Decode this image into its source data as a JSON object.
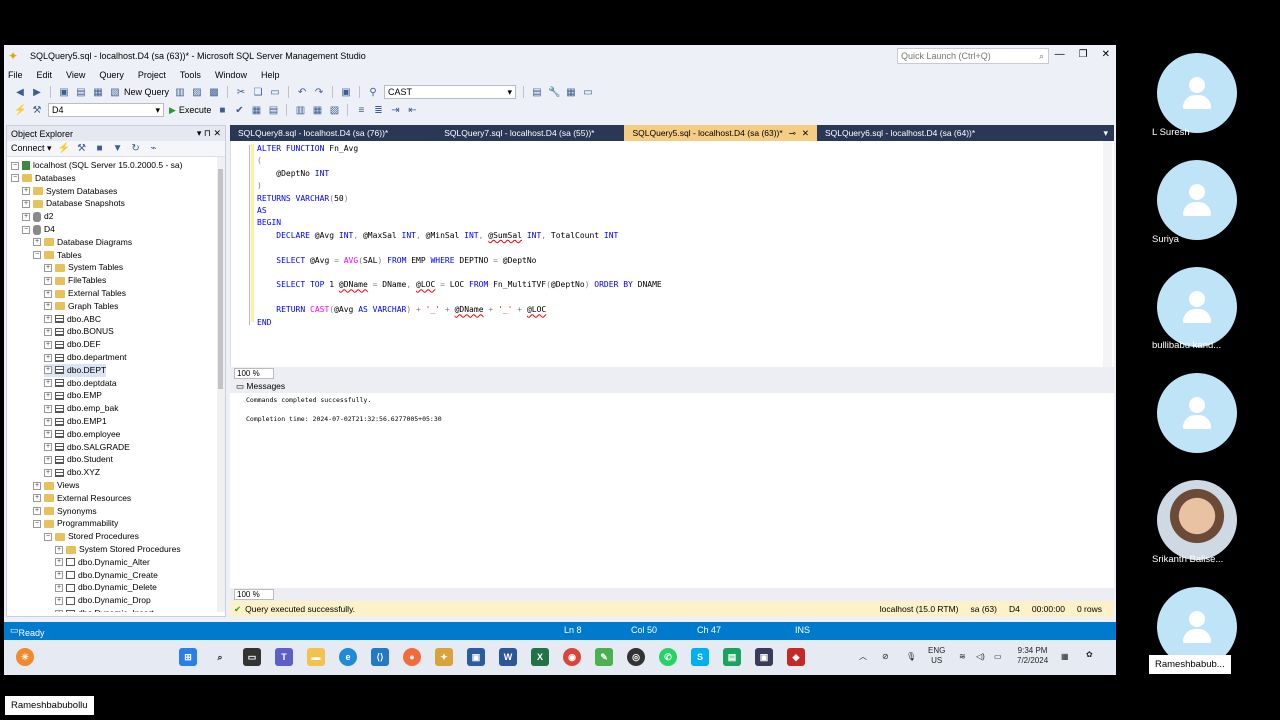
{
  "window": {
    "title": "SQLQuery5.sql - localhost.D4 (sa (63))* - Microsoft SQL Server Management Studio",
    "quick_launch_placeholder": "Quick Launch (Ctrl+Q)"
  },
  "menu": [
    "File",
    "Edit",
    "View",
    "Query",
    "Project",
    "Tools",
    "Window",
    "Help"
  ],
  "toolbar": {
    "new_query": "New Query",
    "search_combo": "CAST",
    "database_combo": "D4",
    "execute": "Execute"
  },
  "object_explorer": {
    "title": "Object Explorer",
    "connect": "Connect",
    "nodes": [
      {
        "label": "localhost (SQL Server 15.0.2000.5 - sa)",
        "icon": "server",
        "exp": "⊟"
      },
      {
        "label": "Databases",
        "icon": "folder",
        "exp": "⊟"
      },
      {
        "label": "System Databases",
        "icon": "folder",
        "exp": "⊞"
      },
      {
        "label": "Database Snapshots",
        "icon": "folder",
        "exp": "⊞"
      },
      {
        "label": "d2",
        "icon": "db",
        "exp": "⊞"
      },
      {
        "label": "D4",
        "icon": "db",
        "exp": "⊟"
      },
      {
        "label": "Database Diagrams",
        "icon": "folder",
        "exp": "⊞"
      },
      {
        "label": "Tables",
        "icon": "folder",
        "exp": "⊟"
      },
      {
        "label": "System Tables",
        "icon": "folder",
        "exp": "⊞"
      },
      {
        "label": "FileTables",
        "icon": "folder",
        "exp": "⊞"
      },
      {
        "label": "External Tables",
        "icon": "folder",
        "exp": "⊞"
      },
      {
        "label": "Graph Tables",
        "icon": "folder",
        "exp": "⊞"
      },
      {
        "label": "dbo.ABC",
        "icon": "table",
        "exp": "⊞"
      },
      {
        "label": "dbo.BONUS",
        "icon": "table",
        "exp": "⊞"
      },
      {
        "label": "dbo.DEF",
        "icon": "table",
        "exp": "⊞"
      },
      {
        "label": "dbo.department",
        "icon": "table",
        "exp": "⊞"
      },
      {
        "label": "dbo.DEPT",
        "icon": "table",
        "exp": "⊞",
        "selected": true
      },
      {
        "label": "dbo.deptdata",
        "icon": "table",
        "exp": "⊞"
      },
      {
        "label": "dbo.EMP",
        "icon": "table",
        "exp": "⊞"
      },
      {
        "label": "dbo.emp_bak",
        "icon": "table",
        "exp": "⊞"
      },
      {
        "label": "dbo.EMP1",
        "icon": "table",
        "exp": "⊞"
      },
      {
        "label": "dbo.employee",
        "icon": "table",
        "exp": "⊞"
      },
      {
        "label": "dbo.SALGRADE",
        "icon": "table",
        "exp": "⊞"
      },
      {
        "label": "dbo.Student",
        "icon": "table",
        "exp": "⊞"
      },
      {
        "label": "dbo.XYZ",
        "icon": "table",
        "exp": "⊞"
      },
      {
        "label": "Views",
        "icon": "folder",
        "exp": "⊞"
      },
      {
        "label": "External Resources",
        "icon": "folder",
        "exp": "⊞"
      },
      {
        "label": "Synonyms",
        "icon": "folder",
        "exp": "⊞"
      },
      {
        "label": "Programmability",
        "icon": "folder",
        "exp": "⊟"
      },
      {
        "label": "Stored Procedures",
        "icon": "folder",
        "exp": "⊟"
      },
      {
        "label": "System Stored Procedures",
        "icon": "folder",
        "exp": "⊞"
      },
      {
        "label": "dbo.Dynamic_Alter",
        "icon": "proc",
        "exp": "⊞"
      },
      {
        "label": "dbo.Dynamic_Create",
        "icon": "proc",
        "exp": "⊞"
      },
      {
        "label": "dbo.Dynamic_Delete",
        "icon": "proc",
        "exp": "⊞"
      },
      {
        "label": "dbo.Dynamic_Drop",
        "icon": "proc",
        "exp": "⊞"
      },
      {
        "label": "dbo.Dynamic_Insert",
        "icon": "proc",
        "exp": "⊞"
      }
    ]
  },
  "tabs": [
    {
      "label": "SQLQuery8.sql - localhost.D4 (sa (76))*",
      "active": false
    },
    {
      "label": "SQLQuery7.sql - localhost.D4 (sa (55))*",
      "active": false
    },
    {
      "label": "SQLQuery5.sql - localhost.D4 (sa (63))*",
      "active": true
    },
    {
      "label": "SQLQuery6.sql - localhost.D4 (sa (64))*",
      "active": false
    }
  ],
  "editor": {
    "zoom": "100 %"
  },
  "messages": {
    "title": "Messages",
    "line1": "Commands completed successfully.",
    "line2": "Completion time: 2024-07-02T21:32:56.6277005+05:30",
    "zoom": "100 %"
  },
  "query_status": {
    "text": "Query executed successfully.",
    "server": "localhost (15.0 RTM)",
    "user": "sa (63)",
    "db": "D4",
    "time": "00:00:00",
    "rows": "0 rows"
  },
  "status_bar": {
    "ready": "Ready",
    "ln": "Ln 8",
    "col": "Col 50",
    "ch": "Ch 47",
    "mode": "INS"
  },
  "taskbar": {
    "lang1": "ENG",
    "lang2": "US",
    "time": "9:34 PM",
    "date": "7/2/2024"
  },
  "participants": [
    {
      "name": "L Suresh"
    },
    {
      "name": "Suriya"
    },
    {
      "name": "bullibabu kand..."
    },
    {
      "name": ""
    },
    {
      "name": "Srikanth Balise..."
    },
    {
      "name": "Rameshbabub..."
    }
  ],
  "presenter": "Rameshbabubollu"
}
